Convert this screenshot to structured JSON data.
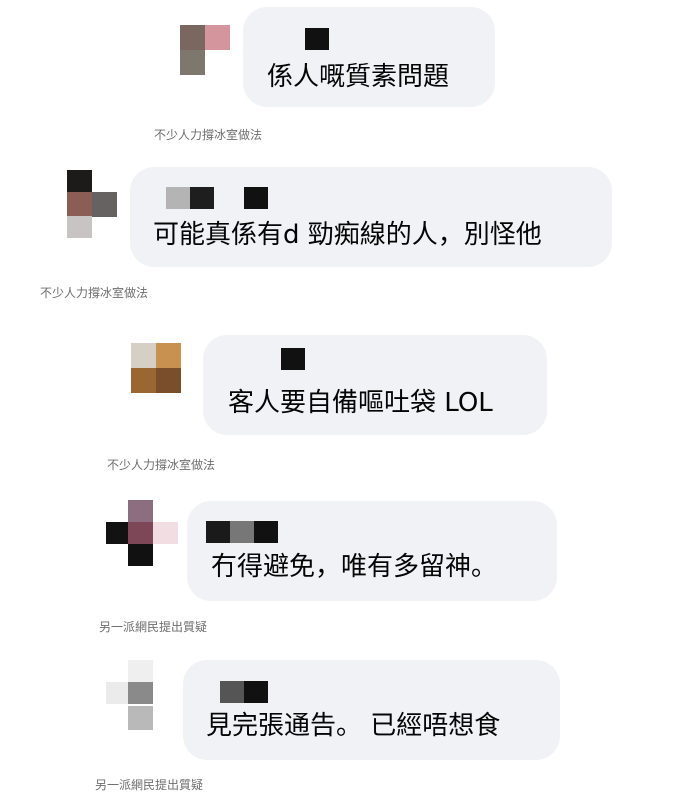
{
  "comments": [
    {
      "text": "係人嘅質素問題",
      "caption": "不少人力撐冰室做法"
    },
    {
      "text": "可能真係有d 勁痴線的人，別怪他",
      "caption": "不少人力撐冰室做法"
    },
    {
      "text": "客人要自備嘔吐袋 LOL",
      "caption": "不少人力撐冰室做法"
    },
    {
      "text": "冇得避免，唯有多留神。",
      "caption": "另一派網民提出質疑"
    },
    {
      "text": "見完張通告。 已經唔想食",
      "caption": "另一派網民提出質疑"
    }
  ],
  "colors": {
    "bubble_bg": "#f0f2f5",
    "caption": "#6e6e6e",
    "text": "#050505",
    "censor": "#111111"
  }
}
